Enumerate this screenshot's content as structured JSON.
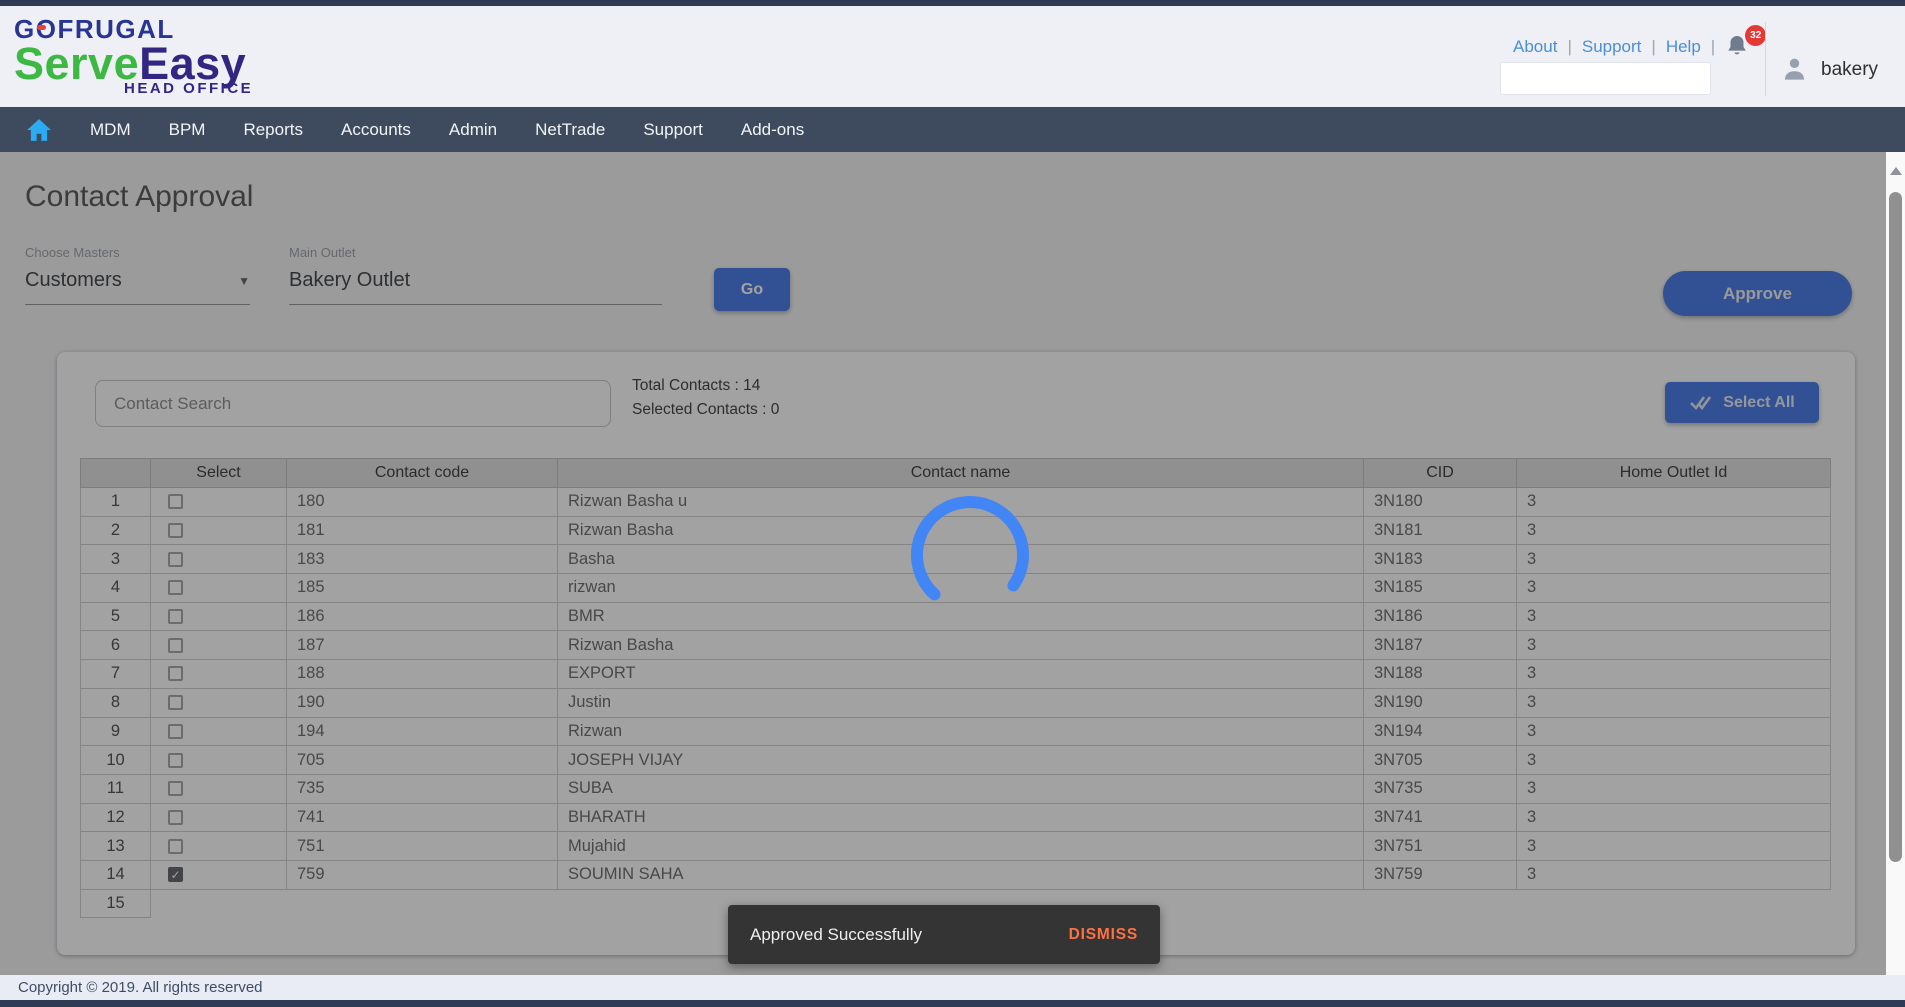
{
  "colors": {
    "accent_blue": "#4379e8",
    "spinner_blue": "#4285f4",
    "dismiss_orange": "#ff7043",
    "badge_red": "#e53935",
    "logo_green": "#3cb843",
    "logo_indigo": "#312783",
    "logo_blue": "#283593",
    "nav_bg": "#3e4a5e"
  },
  "header": {
    "logo": {
      "top": "GOFRUGAL",
      "serve": "Serve",
      "easy": "Easy",
      "sub": "HEAD OFFICE"
    },
    "links": [
      "About",
      "Support",
      "Help"
    ],
    "link_separator": "|",
    "notification_count": "32",
    "search_placeholder": "",
    "username": "bakery"
  },
  "nav": {
    "items": [
      "MDM",
      "BPM",
      "Reports",
      "Accounts",
      "Admin",
      "NetTrade",
      "Support",
      "Add-ons"
    ]
  },
  "page": {
    "title": "Contact Approval",
    "choose_masters_label": "Choose Masters",
    "choose_masters_value": "Customers",
    "main_outlet_label": "Main Outlet",
    "main_outlet_value": "Bakery Outlet",
    "go_label": "Go",
    "approve_label": "Approve"
  },
  "panel": {
    "search_placeholder": "Contact Search",
    "total_contacts": "Total Contacts : 14",
    "selected_contacts": "Selected Contacts : 0",
    "select_all_label": "Select All"
  },
  "table": {
    "headers": [
      "",
      "Select",
      "Contact code",
      "Contact name",
      "CID",
      "Home Outlet Id"
    ],
    "rows": [
      {
        "num": "1",
        "code": "180",
        "name": "Rizwan Basha u",
        "cid": "3N180",
        "home": "3",
        "checked": false
      },
      {
        "num": "2",
        "code": "181",
        "name": "Rizwan Basha",
        "cid": "3N181",
        "home": "3",
        "checked": false
      },
      {
        "num": "3",
        "code": "183",
        "name": "Basha",
        "cid": "3N183",
        "home": "3",
        "checked": false
      },
      {
        "num": "4",
        "code": "185",
        "name": "rizwan",
        "cid": "3N185",
        "home": "3",
        "checked": false
      },
      {
        "num": "5",
        "code": "186",
        "name": "BMR",
        "cid": "3N186",
        "home": "3",
        "checked": false
      },
      {
        "num": "6",
        "code": "187",
        "name": "Rizwan Basha",
        "cid": "3N187",
        "home": "3",
        "checked": false
      },
      {
        "num": "7",
        "code": "188",
        "name": "EXPORT",
        "cid": "3N188",
        "home": "3",
        "checked": false
      },
      {
        "num": "8",
        "code": "190",
        "name": "Justin",
        "cid": "3N190",
        "home": "3",
        "checked": false
      },
      {
        "num": "9",
        "code": "194",
        "name": "Rizwan",
        "cid": "3N194",
        "home": "3",
        "checked": false
      },
      {
        "num": "10",
        "code": "705",
        "name": "JOSEPH VIJAY",
        "cid": "3N705",
        "home": "3",
        "checked": false
      },
      {
        "num": "11",
        "code": "735",
        "name": "SUBA",
        "cid": "3N735",
        "home": "3",
        "checked": false
      },
      {
        "num": "12",
        "code": "741",
        "name": "BHARATH",
        "cid": "3N741",
        "home": "3",
        "checked": false
      },
      {
        "num": "13",
        "code": "751",
        "name": "Mujahid",
        "cid": "3N751",
        "home": "3",
        "checked": false
      },
      {
        "num": "14",
        "code": "759",
        "name": "SOUMIN SAHA",
        "cid": "3N759",
        "home": "3",
        "checked": true
      }
    ],
    "trailing_row_num": "15",
    "checkmark": "✓"
  },
  "toast": {
    "message": "Approved Successfully",
    "action": "DISMISS"
  },
  "footer": {
    "copyright": "Copyright © 2019. All rights reserved"
  }
}
